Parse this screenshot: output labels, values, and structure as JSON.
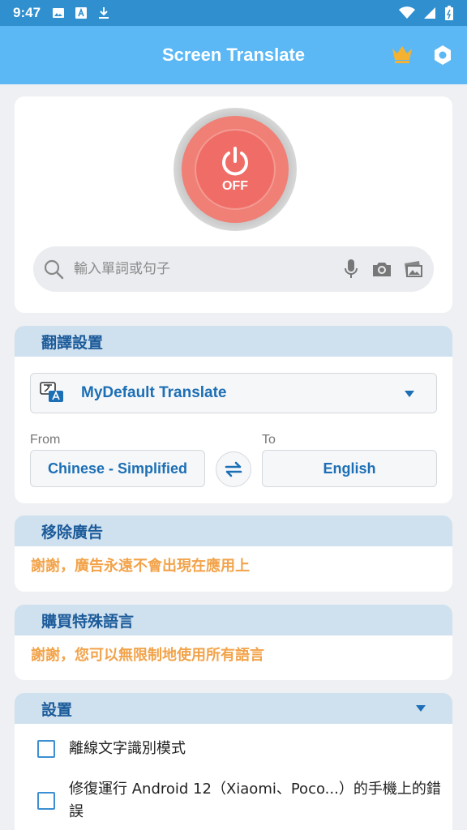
{
  "status_bar": {
    "time": "9:47",
    "left_icons": [
      "image-icon",
      "font-icon",
      "download-icon"
    ],
    "right_icons": [
      "wifi-icon",
      "signal-icon",
      "battery-icon"
    ]
  },
  "app_bar": {
    "title": "Screen Translate",
    "actions": [
      "crown-icon",
      "settings-icon"
    ]
  },
  "power": {
    "state_label": "OFF"
  },
  "search": {
    "placeholder": "輸入單詞或句子",
    "actions": [
      "microphone-icon",
      "camera-icon",
      "image-icon"
    ]
  },
  "translation_settings": {
    "header": "翻譯設置",
    "engine": "MyDefault Translate",
    "from_label": "From",
    "to_label": "To",
    "from_language": "Chinese - Simplified",
    "to_language": "English"
  },
  "remove_ads": {
    "header": "移除廣告",
    "message": "謝謝，廣告永遠不會出現在應用上"
  },
  "buy_languages": {
    "header": "購買特殊語言",
    "message": "謝謝，您可以無限制地使用所有語言"
  },
  "settings": {
    "header": "設置",
    "items": [
      {
        "label": "離線文字識別模式",
        "checked": false
      },
      {
        "label": "修復運行 Android 12（Xiaomi、Poco...）的手機上的錯誤",
        "checked": false
      }
    ]
  },
  "colors": {
    "status_bar": "#2f8fcf",
    "app_bar": "#5bb8f5",
    "power_button": "#f06d67",
    "accent_blue": "#1c6fb5",
    "accent_orange": "#f2a34a",
    "section_header_bg": "#cfe0ee"
  }
}
